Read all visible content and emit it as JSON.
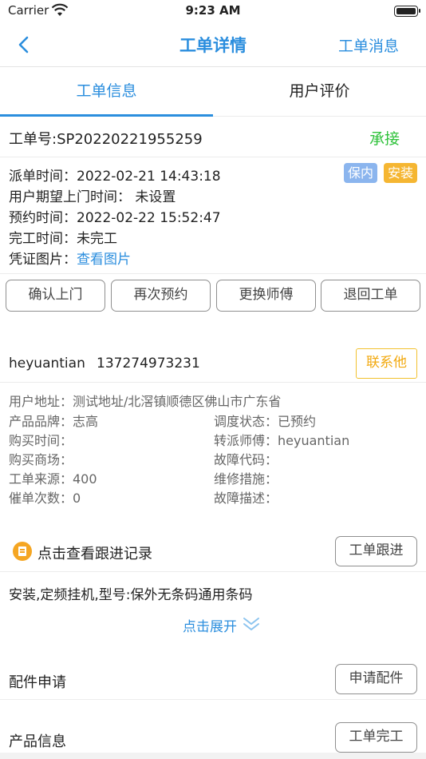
{
  "status_bar": {
    "carrier": "Carrier",
    "time": "9:23 AM"
  },
  "nav": {
    "title": "工单详情",
    "right_label": "工单消息"
  },
  "tabs": [
    {
      "label": "工单信息"
    },
    {
      "label": "用户评价"
    }
  ],
  "order": {
    "number_label": "工单号:SP20220221955259",
    "accept_label": "承接"
  },
  "info": {
    "dispatch_time": "派单时间：2022-02-21 14:43:18",
    "expected_visit": "用户期望上门时间：  未设置",
    "appointment_time": "预约时间：2022-02-22 15:52:47",
    "completion_time": "完工时间：未完工",
    "voucher_label": "凭证图片：",
    "voucher_link": "查看图片",
    "badges": [
      {
        "label": "保内",
        "color": "#8bb5ee"
      },
      {
        "label": "安装",
        "color": "#f5b632"
      }
    ]
  },
  "actions": [
    "确认上门",
    "再次预约",
    "更换师傅",
    "退回工单"
  ],
  "contact": {
    "name": "heyuantian",
    "phone": "137274973231",
    "button": "联系他"
  },
  "details": {
    "address": "用户地址：测试地址/北滘镇顺德区佛山市广东省",
    "brand": "产品品牌：志高",
    "dispatch_status": "调度状态：已预约",
    "purchase_time": "购买时间：",
    "transfer_master": "转派师傅：heyuantian",
    "purchase_store": "购买商场：",
    "fault_code": "故障代码：",
    "source": "工单来源：400",
    "repair_measure": "维修措施：",
    "urge_count": "催单次数：0",
    "fault_desc": "故障描述："
  },
  "follow": {
    "label": "点击查看跟进记录",
    "button": "工单跟进"
  },
  "description": {
    "text": "安装,定频挂机,型号:保外无条码通用条码",
    "expand_label": "点击展开"
  },
  "parts": {
    "title": "配件申请",
    "button": "申请配件"
  },
  "product": {
    "title": "产品信息",
    "button": "工单完工"
  }
}
